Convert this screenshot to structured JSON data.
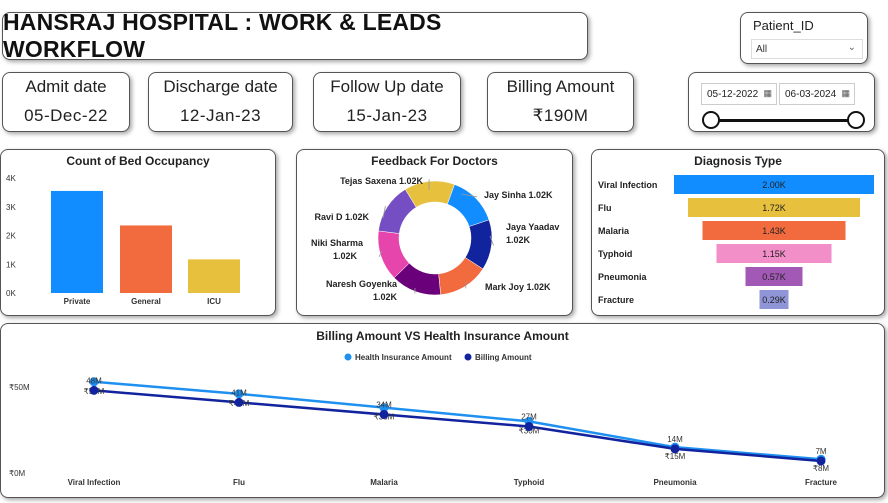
{
  "header": {
    "title": "HANSRAJ HOSPITAL : WORK & LEADS WORKFLOW"
  },
  "kpis": [
    {
      "label": "Admit date",
      "value": "05-Dec-22"
    },
    {
      "label": "Discharge date",
      "value": "12-Jan-23"
    },
    {
      "label": "Follow Up date",
      "value": "15-Jan-23"
    },
    {
      "label": "Billing Amount",
      "value": "₹190M"
    }
  ],
  "patient_slicer": {
    "label": "Patient_ID",
    "value": "All"
  },
  "date_slicer": {
    "start": "05-12-2022",
    "end": "06-03-2024"
  },
  "bed_chart": {
    "title": "Count of Bed Occupancy",
    "chart_data": {
      "type": "bar",
      "categories": [
        "Private",
        "General",
        "ICU"
      ],
      "values": [
        3.55,
        2.35,
        1.17
      ],
      "yticks": [
        "0K",
        "1K",
        "2K",
        "3K",
        "4K"
      ],
      "ylim": [
        0,
        4
      ],
      "colors": [
        "#118DFF",
        "#F26B3E",
        "#E7C03E"
      ]
    }
  },
  "feedback_chart": {
    "title": "Feedback For Doctors",
    "chart_data": {
      "type": "pie",
      "labels": [
        "Jay Sinha",
        "Jaya Yaadav",
        "Mark Joy",
        "Naresh Goyenka",
        "Niki Sharma",
        "Ravi D",
        "Tejas Saxena"
      ],
      "values": [
        1.02,
        1.02,
        1.02,
        1.02,
        1.02,
        1.02,
        1.02
      ],
      "value_labels": [
        "1.02K",
        "1.02K",
        "1.02K",
        "1.02K",
        "1.02K",
        "1.02K",
        "1.02K"
      ],
      "colors": [
        "#118DFF",
        "#12239E",
        "#F26B3E",
        "#6B007B",
        "#E645AB",
        "#744EC2",
        "#E7C03E"
      ]
    }
  },
  "diagnosis_chart": {
    "title": "Diagnosis Type",
    "chart_data": {
      "type": "bar",
      "categories": [
        "Viral Infection",
        "Flu",
        "Malaria",
        "Typhoid",
        "Pneumonia",
        "Fracture"
      ],
      "values": [
        2.0,
        1.72,
        1.43,
        1.15,
        0.57,
        0.29
      ],
      "value_labels": [
        "2.00K",
        "1.72K",
        "1.43K",
        "1.15K",
        "0.57K",
        "0.29K"
      ],
      "colors": [
        "#118DFF",
        "#E7C03E",
        "#F26B3E",
        "#F28EC8",
        "#A259B5",
        "#8F95D6"
      ]
    }
  },
  "billing_chart": {
    "title": "Billing Amount VS Health Insurance Amount",
    "chart_data": {
      "type": "line",
      "categories": [
        "Viral Infection",
        "Flu",
        "Malaria",
        "Typhoid",
        "Pneumonia",
        "Fracture"
      ],
      "yticks": [
        "₹0M",
        "₹50M"
      ],
      "ylim": [
        0,
        61
      ],
      "series": [
        {
          "name": "Health Insurance Amount",
          "color": "#1E90F0",
          "values": [
            53,
            46,
            38,
            30,
            15,
            8
          ],
          "labels": [
            "₹53M",
            "₹46M",
            "₹38M",
            "₹30M",
            "₹15M",
            "₹8M"
          ]
        },
        {
          "name": "Billing Amount",
          "color": "#12239E",
          "values": [
            48,
            41,
            34,
            27,
            14,
            7
          ],
          "labels": [
            "48M",
            "41M",
            "34M",
            "27M",
            "14M",
            "7M"
          ]
        }
      ]
    }
  }
}
